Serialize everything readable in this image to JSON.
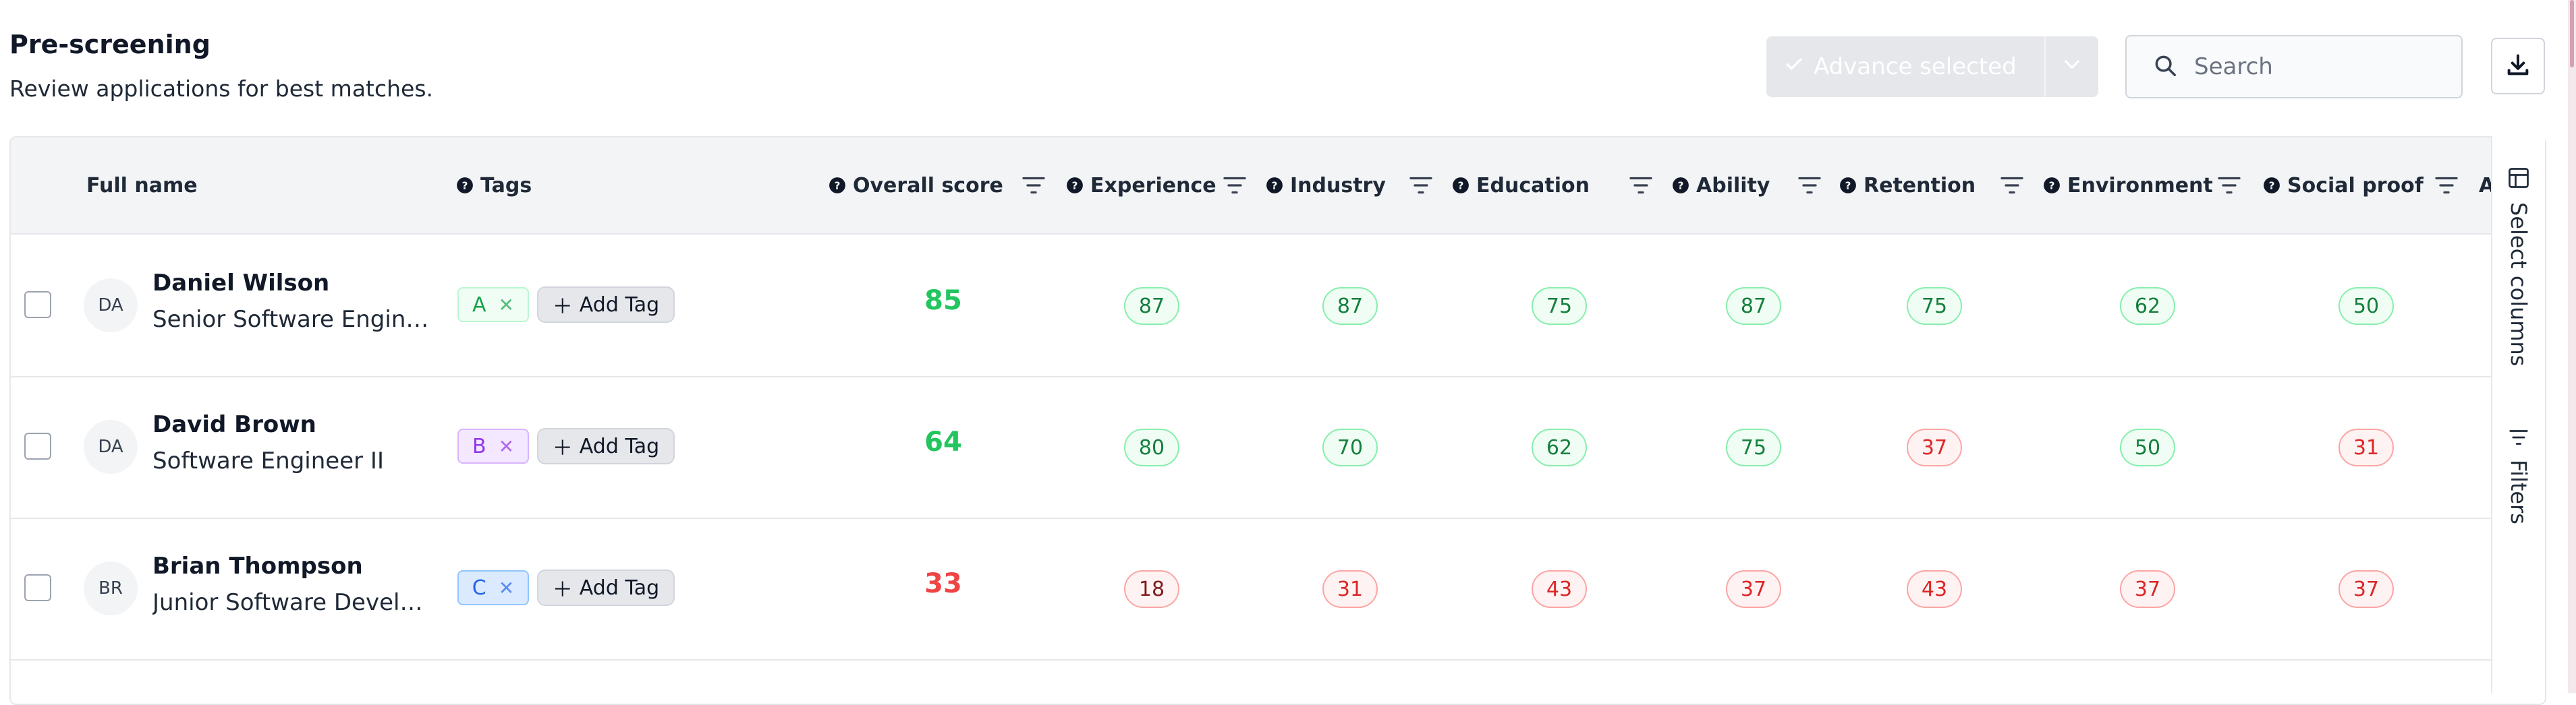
{
  "header": {
    "title": "Pre-screening",
    "subtitle": "Review applications for best matches."
  },
  "toolbar": {
    "advance_label": "Advance selected",
    "search_placeholder": "Search",
    "search_value": ""
  },
  "columns": {
    "full_name": "Full name",
    "tags": "Tags",
    "overall_score": "Overall score",
    "experience": "Experience",
    "industry": "Industry",
    "education": "Education",
    "ability": "Ability",
    "retention": "Retention",
    "environment": "Environment",
    "social_proof": "Social proof",
    "truncated_next": "A"
  },
  "tags": {
    "add_label": "Add Tag"
  },
  "side_panel": {
    "select_columns": "Select columns",
    "filters": "Filters"
  },
  "rows": [
    {
      "initials": "DA",
      "name": "Daniel Wilson",
      "role": "Senior Software Engineer",
      "tag": "A",
      "overall": "85",
      "experience": "87",
      "industry": "87",
      "education": "75",
      "ability": "87",
      "retention": "75",
      "environment": "62",
      "social_proof": "50"
    },
    {
      "initials": "DA",
      "name": "David Brown",
      "role": "Software Engineer II",
      "tag": "B",
      "overall": "64",
      "experience": "80",
      "industry": "70",
      "education": "62",
      "ability": "75",
      "retention": "37",
      "environment": "50",
      "social_proof": "31"
    },
    {
      "initials": "BR",
      "name": "Brian Thompson",
      "role": "Junior Software Developer",
      "tag": "C",
      "overall": "33",
      "experience": "18",
      "industry": "31",
      "education": "43",
      "ability": "37",
      "retention": "43",
      "environment": "37",
      "social_proof": "37"
    }
  ],
  "colors": {
    "score_good": "#22c55e",
    "score_bad": "#ef4444",
    "tag_a_bg": "#f0fdf4",
    "tag_a_fg": "#16a34a",
    "tag_b_bg": "#f3e8ff",
    "tag_b_fg": "#9333ea",
    "tag_c_bg": "#dbeafe",
    "tag_c_fg": "#2563eb"
  },
  "icons": [
    "check-icon",
    "chevron-down-icon",
    "search-icon",
    "download-icon",
    "help-icon",
    "filter-icon",
    "plus-icon",
    "close-icon",
    "table-columns-icon",
    "filters-icon"
  ]
}
